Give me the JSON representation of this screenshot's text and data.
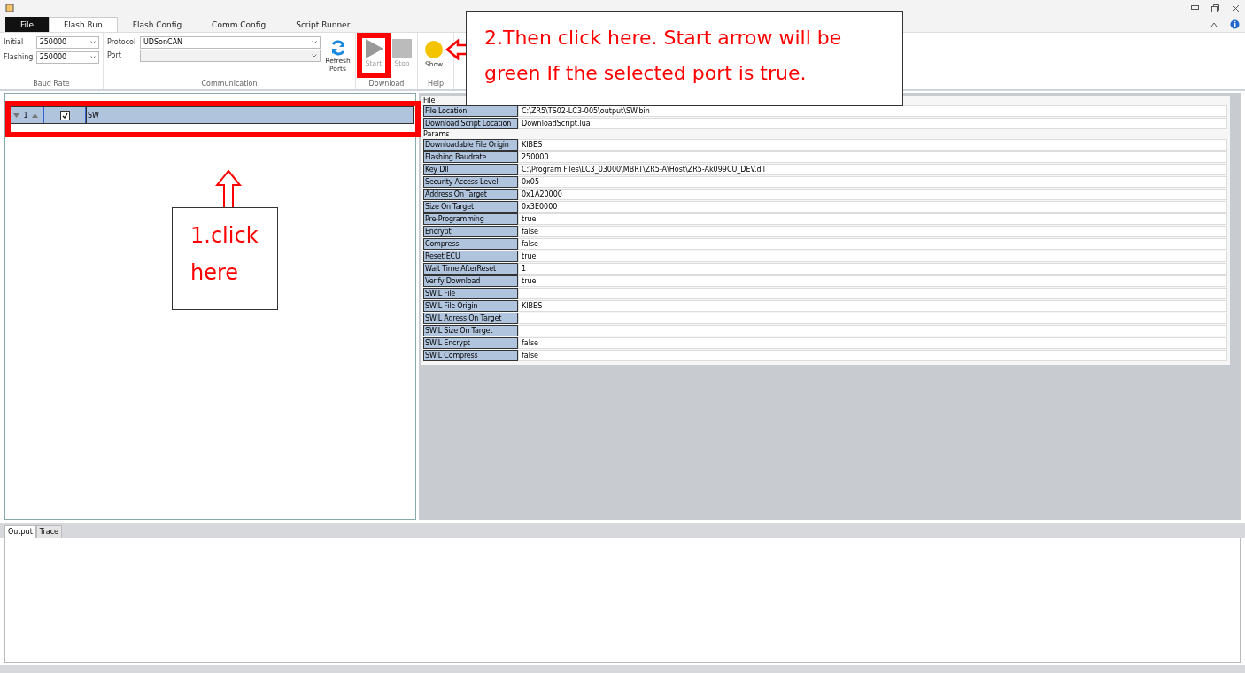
{
  "menu_tabs": [
    {
      "label": "File",
      "kind": "file",
      "selected": false
    },
    {
      "label": "Flash Run",
      "kind": "tab",
      "selected": true
    },
    {
      "label": "Flash Config",
      "kind": "tab",
      "selected": false
    },
    {
      "label": "Comm Config",
      "kind": "tab",
      "selected": false
    },
    {
      "label": "Script Runner",
      "kind": "tab",
      "selected": false
    }
  ],
  "baud_rate": {
    "title": "Baud Rate",
    "fields": [
      {
        "label": "Initial",
        "value": "250000"
      },
      {
        "label": "Flashing",
        "value": "250000"
      }
    ]
  },
  "communication": {
    "title": "Communication",
    "protocol_label": "Protocol",
    "protocol": "UDSonCAN",
    "port_label": "Port",
    "refresh": "Refresh Ports"
  },
  "download": {
    "title": "Download",
    "buttons": [
      {
        "label": "Start",
        "kind": "start",
        "disabled": true
      },
      {
        "label": "Stop",
        "kind": "stop",
        "disabled": true
      }
    ]
  },
  "help": {
    "title": "Help",
    "button": "Show"
  },
  "grid": {
    "rows": [
      {
        "index": "1",
        "checked": true,
        "file": "SW",
        "selected": true
      }
    ]
  },
  "properties": [
    {
      "title": "File",
      "rows": [
        {
          "name": "File Location",
          "value": "C:\\ZR5\\TS02-LC3-005\\output\\SW.bin"
        },
        {
          "name": "Download Script Location",
          "value": "DownloadScript.lua"
        }
      ]
    },
    {
      "title": "Params",
      "rows": [
        {
          "name": "Downloadable File Origin",
          "value": "KIBES"
        },
        {
          "name": "Flashing Baudrate",
          "value": "250000"
        },
        {
          "name": "Key Dll",
          "value": "C:\\Program Files\\LC3_03000\\MBRT\\ZR5-A\\Host\\ZR5-Ak099CU_DEV.dll"
        },
        {
          "name": "Security Access Level",
          "value": "0x05"
        },
        {
          "name": "Address On Target",
          "value": "0x1A20000"
        },
        {
          "name": "Size On Target",
          "value": "0x3E0000"
        },
        {
          "name": "Pre-Programming",
          "value": "true"
        },
        {
          "name": "Encrypt",
          "value": "false"
        },
        {
          "name": "Compress",
          "value": "false"
        },
        {
          "name": "Reset ECU",
          "value": "true"
        },
        {
          "name": "Wait Time AfterReset",
          "value": "1"
        },
        {
          "name": "Verify Download",
          "value": "true"
        },
        {
          "name": "SWIL File",
          "value": ""
        },
        {
          "name": "SWIL File Origin",
          "value": "KIBES"
        },
        {
          "name": "SWIL Adress On Target",
          "value": ""
        },
        {
          "name": "SWIL Size On Target",
          "value": ""
        },
        {
          "name": "SWIL Encrypt",
          "value": "false"
        },
        {
          "name": "SWIL Compress",
          "value": "false"
        }
      ]
    }
  ],
  "output_tabs": [
    {
      "label": "Output",
      "selected": true
    },
    {
      "label": "Trace",
      "selected": false
    }
  ],
  "annotations": {
    "step1": "1.click here",
    "step2": "2.Then click here. Start arrow will be green If the selected port is true."
  }
}
